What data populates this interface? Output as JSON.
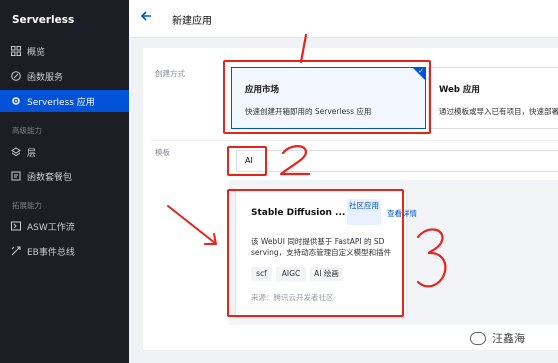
{
  "sidebar": {
    "brand": "Serverless",
    "items": [
      {
        "label": "概览"
      },
      {
        "label": "函数服务"
      },
      {
        "label": "Serverless 应用"
      },
      {
        "label": "层"
      },
      {
        "label": "函数套餐包"
      },
      {
        "label": "ASW工作流"
      },
      {
        "label": "EB事件总线"
      }
    ],
    "groups": [
      "高级能力",
      "拓展能力"
    ]
  },
  "header": {
    "back_icon": "arrow-left-icon",
    "title": "新建应用"
  },
  "form": {
    "method_label": "创建方式",
    "template_label": "模板",
    "market": {
      "title": "应用市场",
      "desc": "快速创建开箱即用的 Serverless 应用"
    },
    "web": {
      "title": "Web 应用",
      "desc": "通过模板或导入已有项目，快速部署"
    },
    "search_value": "AI"
  },
  "template_card": {
    "name": "Stable Diffusion ...",
    "badge": "社区应用",
    "detail_link": "查看详情",
    "desc": "该 WebUI 同时提供基于 FastAPI 的 SD serving，支持动态管理自定义模型和插件",
    "tags": [
      "scf",
      "AIGC",
      "AI 绘画"
    ],
    "source": "来源：腾讯云开发者社区"
  },
  "annotations": {
    "n1": "1",
    "n2": "2",
    "n3": "3"
  },
  "watermark": "汪鑫海",
  "colors": {
    "sidebar_bg": "#1c1e26",
    "accent": "#0052d9",
    "annotation": "#e8231a"
  }
}
